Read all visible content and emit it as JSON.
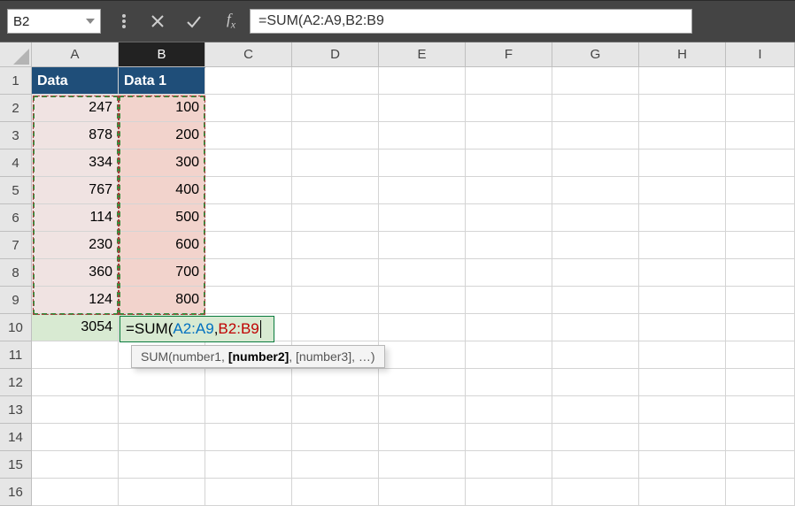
{
  "name_box": "B2",
  "formula_bar": "=SUM(A2:A9,B2:B9",
  "columns": [
    "A",
    "B",
    "C",
    "D",
    "E",
    "F",
    "G",
    "H",
    "I"
  ],
  "col_widths": {
    "A": 98,
    "B": 98,
    "C": 98,
    "D": 98,
    "E": 98,
    "F": 98,
    "G": 98,
    "H": 98,
    "I": 78
  },
  "active_col": "B",
  "rows_visible": 16,
  "headers": {
    "A": "Data",
    "B": "Data 1"
  },
  "data": {
    "A": [
      247,
      878,
      334,
      767,
      114,
      230,
      360,
      124
    ],
    "B": [
      100,
      200,
      300,
      400,
      500,
      600,
      700,
      800
    ]
  },
  "a10": 3054,
  "formula_edit_parts": {
    "prefix": "=SUM(",
    "arg1": "A2:A9",
    "sep": ",",
    "arg2": "B2:B9"
  },
  "tooltip": "SUM(number1, [number2], [number3], …)",
  "tooltip_bold": "[number2]"
}
